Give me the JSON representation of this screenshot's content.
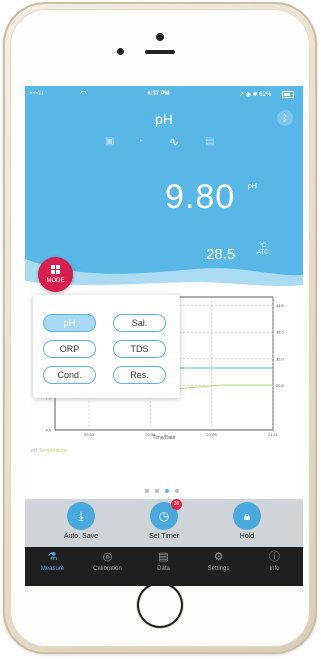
{
  "status_bar": {
    "signal": "•••ll",
    "time": "4:37 PM",
    "right": "↗ ◉ ✱ 62%"
  },
  "header": {
    "title": "pH",
    "mode_icons": [
      "square-icon",
      "gauge-icon",
      "trend-icon",
      "list-icon"
    ],
    "bluetooth_icon": "bluetooth-icon"
  },
  "reading": {
    "value": "9.80",
    "unit": "pH",
    "temperature": "28.5",
    "temp_unit": "°C",
    "temp_mode": "ATC"
  },
  "mode_button": {
    "label": "MODE"
  },
  "mode_menu": {
    "options": [
      {
        "label": "pH",
        "selected": true
      },
      {
        "label": "Sal.",
        "selected": false
      },
      {
        "label": "ORP",
        "selected": false
      },
      {
        "label": "TDS",
        "selected": false
      },
      {
        "label": "Cond.",
        "selected": false
      },
      {
        "label": "Res.",
        "selected": false
      }
    ]
  },
  "chart_data": {
    "type": "line",
    "x_tick_labels": [
      "20:53",
      "20:59",
      "21:05",
      "21:11"
    ],
    "xlabel": "Time/Date",
    "y_left_ticks": [
      "7.0",
      "4.0"
    ],
    "y_right_ticks": [
      "44.0",
      "38.0",
      "32.0",
      "26.0"
    ],
    "series": [
      {
        "name": "pH",
        "color": "#5bb6e8",
        "values": [
          9.9,
          9.8,
          9.8,
          9.8,
          9.8
        ]
      },
      {
        "name": "Temperature",
        "color": "#b7d27a",
        "values": [
          28.4,
          28.3,
          28.4,
          28.5,
          28.5
        ]
      }
    ],
    "legend": [
      "pH",
      "Temperature"
    ]
  },
  "pager": {
    "pages": 4,
    "current": 3
  },
  "actions": [
    {
      "label": "Auto. Save",
      "icon": "save-icon"
    },
    {
      "label": "Set Timer",
      "icon": "clock-icon",
      "badge": "36"
    },
    {
      "label": "Hold",
      "icon": "lock-icon"
    }
  ],
  "tabs": [
    {
      "label": "Measure",
      "icon": "flask-icon",
      "active": true
    },
    {
      "label": "Calibration",
      "icon": "target-icon",
      "active": false
    },
    {
      "label": "Data",
      "icon": "document-icon",
      "active": false
    },
    {
      "label": "Settings",
      "icon": "gear-icon",
      "active": false
    },
    {
      "label": "Info",
      "icon": "info-icon",
      "active": false
    }
  ],
  "colors": {
    "accent": "#58b7e6",
    "mode_button": "#d51f4f",
    "tabbar": "#1f1f1f",
    "action_bar": "#cfd4d8"
  }
}
